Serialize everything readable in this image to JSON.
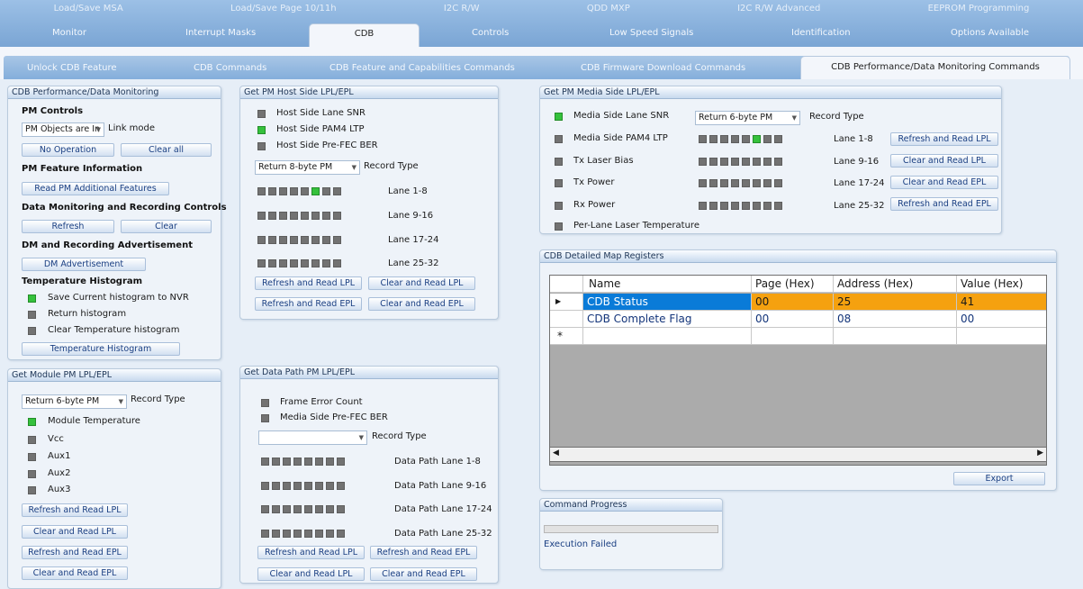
{
  "top_tabs_row1": [
    "Load/Save MSA",
    "Load/Save Page 10/11h",
    "I2C R/W",
    "QDD MXP",
    "I2C R/W Advanced",
    "EEPROM Programming"
  ],
  "top_tabs_row2": [
    "Monitor",
    "Interrupt Masks",
    "CDB",
    "Controls",
    "Low Speed Signals",
    "Identification",
    "Options Available"
  ],
  "sub_tabs": [
    "Unlock CDB Feature",
    "CDB Commands",
    "CDB Feature and Capabilities Commands",
    "CDB Firmware Download Commands",
    "CDB Performance/Data Monitoring Commands"
  ],
  "pm_monitoring": {
    "title": "CDB Performance/Data Monitoring",
    "pm_controls": "PM Controls",
    "pm_combo": "PM Objects are In",
    "link_mode": "Link mode",
    "no_operation": "No Operation",
    "clear_all": "Clear all",
    "pm_feature_info": "PM Feature Information",
    "read_pm_additional": "Read PM Additional Features",
    "dm_controls": "Data Monitoring and Recording Controls",
    "refresh": "Refresh",
    "clear": "Clear",
    "dm_advertisement_heading": "DM and Recording Advertisement",
    "dm_advertisement_btn": "DM Advertisement",
    "temp_histogram_heading": "Temperature Histogram",
    "save_histogram": "Save Current histogram to NVR",
    "return_histogram": "Return histogram",
    "clear_temp_histogram": "Clear Temperature histogram",
    "temp_histogram_btn": "Temperature Histogram"
  },
  "module_pm": {
    "title": "Get Module PM LPL/EPL",
    "record_combo": "Return 6-byte PM",
    "record_type": "Record Type",
    "items": [
      "Module Temperature",
      "Vcc",
      "Aux1",
      "Aux2",
      "Aux3"
    ],
    "refresh_lpl": "Refresh and Read LPL",
    "clear_lpl": "Clear and Read LPL",
    "refresh_epl": "Refresh and Read EPL",
    "clear_epl": "Clear and Read EPL"
  },
  "host_pm": {
    "title": "Get PM Host Side LPL/EPL",
    "items": [
      "Host Side Lane SNR",
      "Host Side PAM4 LTP",
      "Host Side Pre-FEC BER"
    ],
    "record_combo": "Return 8-byte PM",
    "record_type": "Record Type",
    "lanes": [
      "Lane 1-8",
      "Lane 9-16",
      "Lane 17-24",
      "Lane 25-32"
    ],
    "refresh_lpl": "Refresh and Read LPL",
    "clear_lpl": "Clear and Read LPL",
    "refresh_epl": "Refresh and Read EPL",
    "clear_epl": "Clear and Read EPL"
  },
  "data_path_pm": {
    "title": "Get Data Path PM LPL/EPL",
    "items": [
      "Frame Error Count",
      "Media Side Pre-FEC BER"
    ],
    "record_combo": "",
    "record_type": "Record Type",
    "lanes": [
      "Data Path Lane 1-8",
      "Data Path Lane 9-16",
      "Data Path Lane 17-24",
      "Data Path Lane 25-32"
    ],
    "refresh_lpl": "Refresh and Read LPL",
    "refresh_epl": "Refresh and Read EPL",
    "clear_lpl": "Clear and Read LPL",
    "clear_epl": "Clear and Read EPL"
  },
  "media_pm": {
    "title": "Get PM Media Side LPL/EPL",
    "items": [
      "Media Side Lane SNR",
      "Media Side PAM4 LTP",
      "Tx Laser Bias",
      "Tx Power",
      "Rx Power",
      "Per-Lane Laser Temperature"
    ],
    "record_combo": "Return 6-byte PM",
    "record_type": "Record Type",
    "lanes": [
      "Lane 1-8",
      "Lane 9-16",
      "Lane 17-24",
      "Lane 25-32"
    ],
    "refresh_lpl": "Refresh and Read LPL",
    "clear_lpl": "Clear and Read LPL",
    "clear_epl": "Clear and Read EPL",
    "refresh_epl": "Refresh and Read EPL"
  },
  "map_registers": {
    "title": "CDB Detailed Map Registers",
    "columns": [
      "Name",
      "Page (Hex)",
      "Address (Hex)",
      "Value (Hex)"
    ],
    "rows": [
      {
        "name": "CDB Status",
        "page": "00",
        "address": "25",
        "value": "41"
      },
      {
        "name": "CDB Complete Flag",
        "page": "00",
        "address": "08",
        "value": "00"
      }
    ],
    "export": "Export"
  },
  "command_progress": {
    "title": "Command Progress",
    "progress": 0,
    "status": "Execution Failed"
  },
  "colors": {
    "header_bg": "#8ab1dc",
    "checkbox_on": "#35c13c",
    "checkbox_off": "#727272",
    "selected_row": "#0a7bd8",
    "highlight_row": "#f5a10f",
    "link_text": "#1a3f82"
  }
}
